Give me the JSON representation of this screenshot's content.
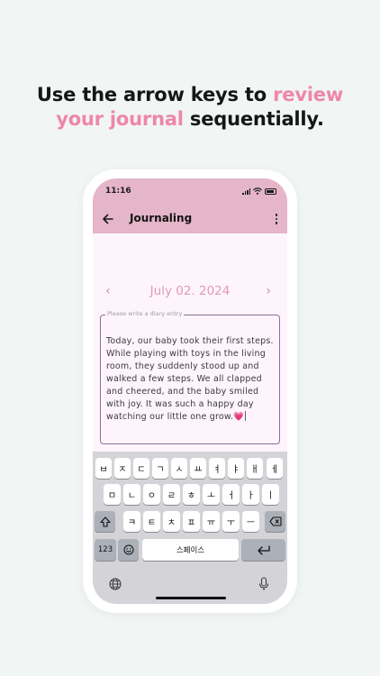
{
  "headline": {
    "line1_plain": "Use the arrow keys to ",
    "line1_accent": "review",
    "line2_accent": "your journal",
    "line2_plain": " sequentially."
  },
  "colors": {
    "accent": "#ee86ab",
    "app_bar": "#e5b5c8",
    "screen_bg": "#fdf5fb",
    "field_border": "#8f6d9c"
  },
  "status_bar": {
    "time": "11:16"
  },
  "app_bar": {
    "title": "Journaling",
    "back_icon": "arrow-left-icon",
    "menu_icon": "more-vertical-icon"
  },
  "journal": {
    "date": "July 02. 2024",
    "prev_icon": "chevron-left-icon",
    "next_icon": "chevron-right-icon",
    "entry_placeholder": "Please write a diary entry",
    "entry_text": "Today, our baby took their first steps. While playing with toys in the living room, they suddenly stood up and walked a few steps. We all clapped and cheered, and the baby smiled with joy. It was such a happy day watching our little one grow.💗"
  },
  "keyboard": {
    "row1": [
      "ㅂ",
      "ㅈ",
      "ㄷ",
      "ㄱ",
      "ㅅ",
      "ㅛ",
      "ㅕ",
      "ㅑ",
      "ㅐ",
      "ㅔ"
    ],
    "row2": [
      "ㅁ",
      "ㄴ",
      "ㅇ",
      "ㄹ",
      "ㅎ",
      "ㅗ",
      "ㅓ",
      "ㅏ",
      "ㅣ"
    ],
    "row3": [
      "ㅋ",
      "ㅌ",
      "ㅊ",
      "ㅍ",
      "ㅠ",
      "ㅜ",
      "ㅡ"
    ],
    "shift_icon": "shift-icon",
    "delete_icon": "backspace-icon",
    "numbers_label": "123",
    "emoji_icon": "emoji-icon",
    "space_label": "스페이스",
    "return_icon": "return-icon",
    "globe_icon": "globe-icon",
    "mic_icon": "microphone-icon"
  }
}
